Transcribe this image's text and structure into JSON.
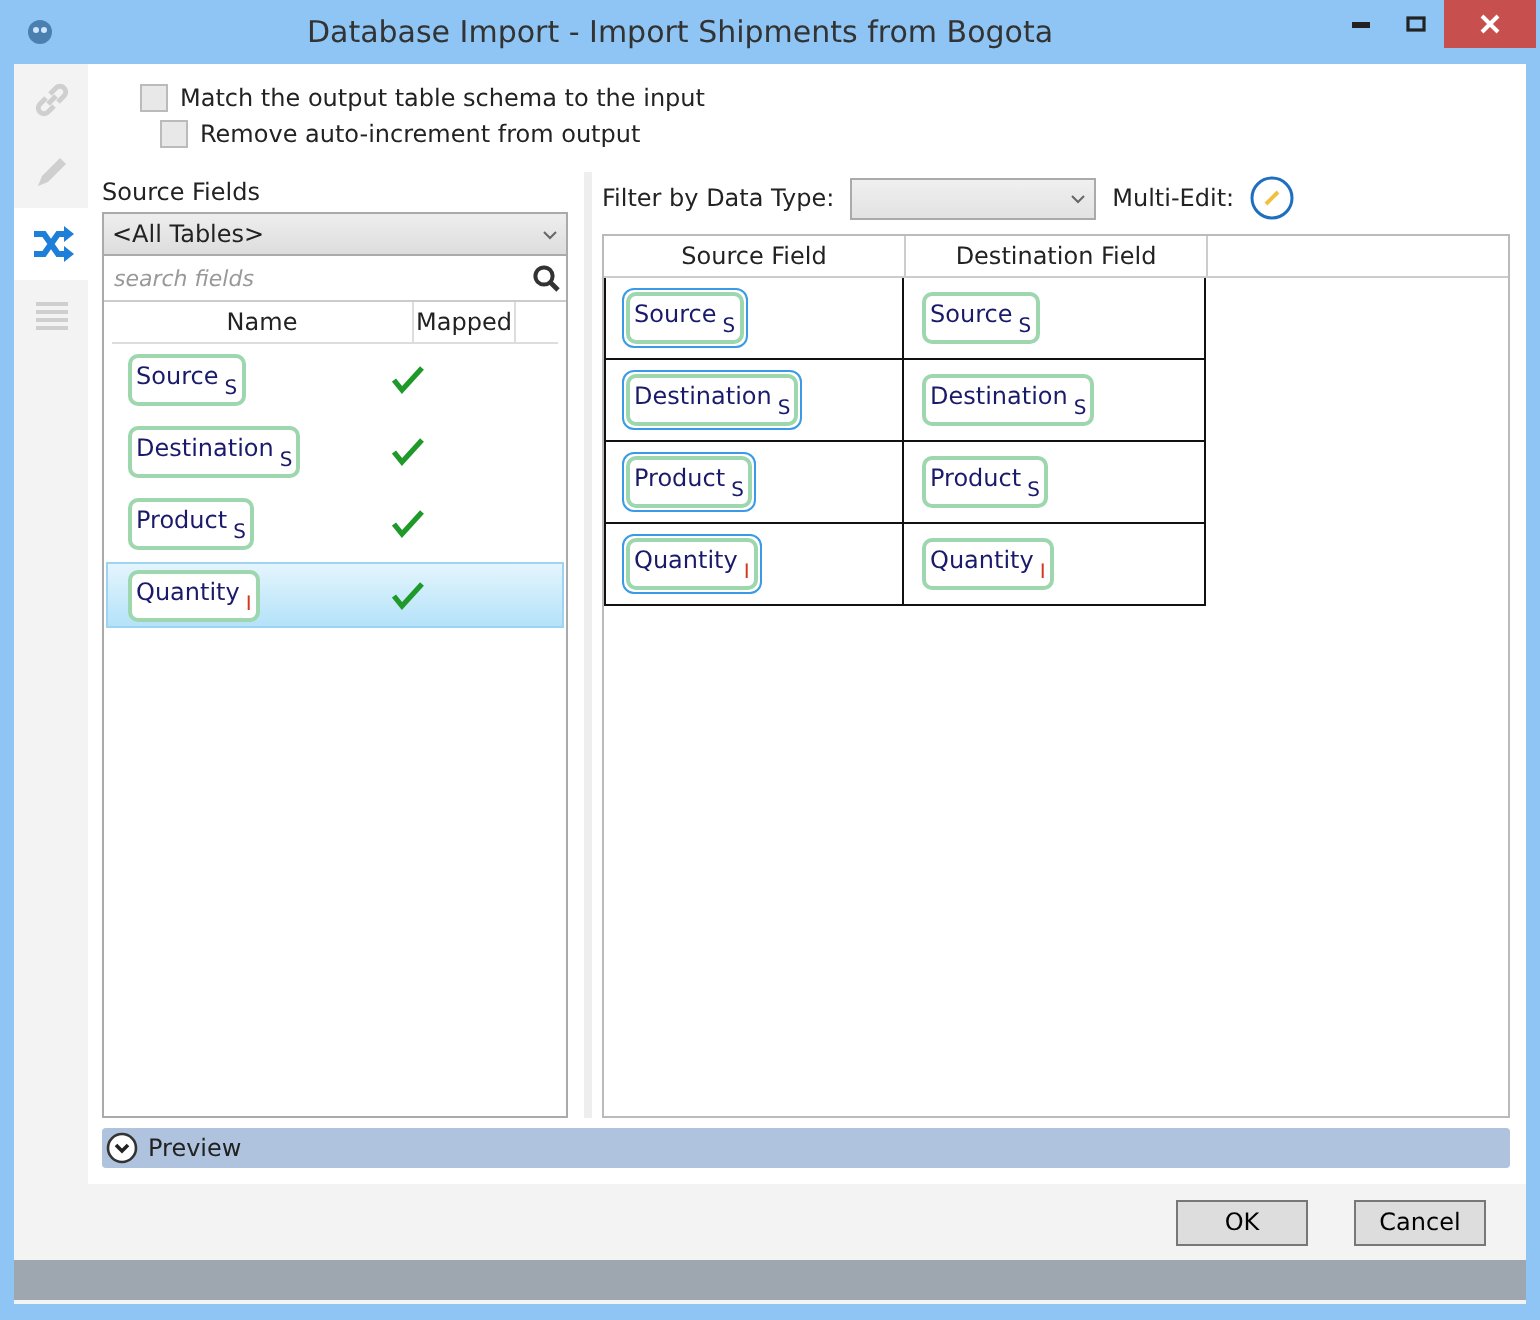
{
  "window": {
    "title": "Database Import - Import Shipments from Bogota"
  },
  "sidebar": {
    "tabs": [
      {
        "kind": "link",
        "selected": false
      },
      {
        "kind": "pencil",
        "selected": false
      },
      {
        "kind": "shuffle",
        "selected": true
      },
      {
        "kind": "list",
        "selected": false
      }
    ]
  },
  "options": [
    {
      "label": "Match the output table schema to the input",
      "checked": false,
      "indented": false
    },
    {
      "label": "Remove auto-increment from output",
      "checked": false,
      "indented": true
    }
  ],
  "source_panel": {
    "title": "Source Fields",
    "table_select": "<All Tables>",
    "search": {
      "placeholder": "search fields"
    },
    "columns": [
      "Name",
      "Mapped"
    ],
    "rows": [
      {
        "name": "Source",
        "type": "S",
        "mapped": true,
        "selected": false
      },
      {
        "name": "Destination",
        "type": "S",
        "mapped": true,
        "selected": false
      },
      {
        "name": "Product",
        "type": "S",
        "mapped": true,
        "selected": false
      },
      {
        "name": "Quantity",
        "type": "I",
        "mapped": true,
        "selected": true
      }
    ]
  },
  "mapping_panel": {
    "filter_label": "Filter by Data Type:",
    "multi_edit_label": "Multi-Edit:",
    "columns": [
      "Source Field",
      "Destination Field"
    ],
    "rows": [
      {
        "source": {
          "name": "Source",
          "type": "S"
        },
        "destination": {
          "name": "Source",
          "type": "S"
        }
      },
      {
        "source": {
          "name": "Destination",
          "type": "S"
        },
        "destination": {
          "name": "Destination",
          "type": "S"
        }
      },
      {
        "source": {
          "name": "Product",
          "type": "S"
        },
        "destination": {
          "name": "Product",
          "type": "S"
        }
      },
      {
        "source": {
          "name": "Quantity",
          "type": "I"
        },
        "destination": {
          "name": "Quantity",
          "type": "I"
        }
      }
    ]
  },
  "preview": {
    "label": "Preview",
    "expanded": false
  },
  "buttons": [
    "OK",
    "Cancel"
  ]
}
